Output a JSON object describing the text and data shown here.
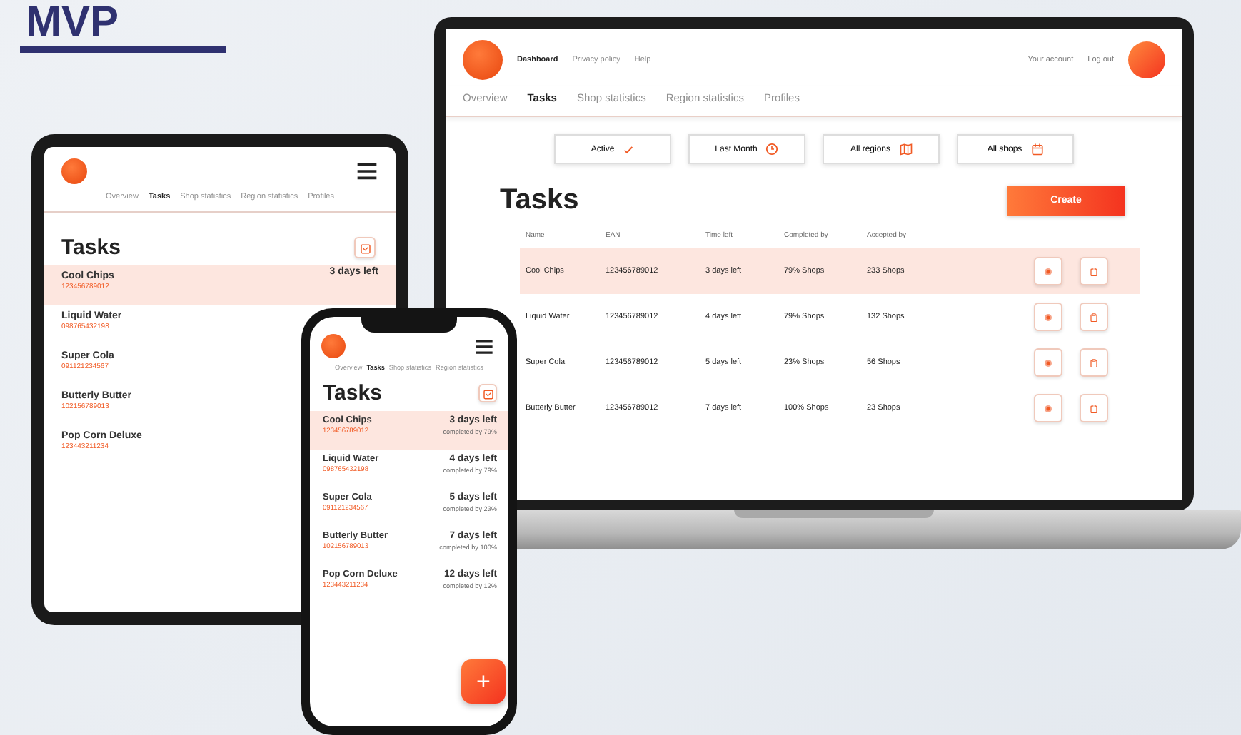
{
  "heading": "MVP",
  "laptop": {
    "top_links": [
      {
        "label": "Dashboard",
        "selected": true
      },
      {
        "label": "Privacy policy",
        "selected": false
      },
      {
        "label": "Help",
        "selected": false
      }
    ],
    "account_links": [
      "Your account",
      "Log out"
    ],
    "tabs": [
      {
        "label": "Overview",
        "selected": false
      },
      {
        "label": "Tasks",
        "selected": true
      },
      {
        "label": "Shop statistics",
        "selected": false
      },
      {
        "label": "Region statistics",
        "selected": false
      },
      {
        "label": "Profiles",
        "selected": false
      }
    ],
    "filters": [
      {
        "label": "Active"
      },
      {
        "label": "Last Month"
      },
      {
        "label": "All regions"
      },
      {
        "label": "All shops"
      }
    ],
    "title": "Tasks",
    "create_button": "Create",
    "columns": [
      "Name",
      "EAN",
      "Time left",
      "Completed by",
      "Accepted by"
    ],
    "rows": [
      {
        "cells": [
          "Cool Chips",
          "123456789012",
          "3 days left",
          "79% Shops",
          "233 Shops"
        ],
        "selected": true
      },
      {
        "cells": [
          "Liquid Water",
          "123456789012",
          "4 days left",
          "79% Shops",
          "132 Shops"
        ],
        "selected": false
      },
      {
        "cells": [
          "Super Cola",
          "123456789012",
          "5 days left",
          "23% Shops",
          "56 Shops"
        ],
        "selected": false
      },
      {
        "cells": [
          "Butterly Butter",
          "123456789012",
          "7 days left",
          "100% Shops",
          "23 Shops"
        ],
        "selected": false
      }
    ]
  },
  "tablet": {
    "tabs": [
      {
        "label": "Overview",
        "selected": false
      },
      {
        "label": "Tasks",
        "selected": true
      },
      {
        "label": "Shop statistics",
        "selected": false
      },
      {
        "label": "Region statistics",
        "selected": false
      },
      {
        "label": "Profiles",
        "selected": false
      }
    ],
    "title": "Tasks",
    "items": [
      {
        "name": "Cool Chips",
        "ean": "123456789012",
        "time_left": "3 days left",
        "selected": true
      },
      {
        "name": "Liquid Water",
        "ean": "098765432198",
        "selected": false
      },
      {
        "name": "Super Cola",
        "ean": "091121234567",
        "selected": false
      },
      {
        "name": "Butterly Butter",
        "ean": "102156789013",
        "selected": false
      },
      {
        "name": "Pop Corn Deluxe",
        "ean": "123443211234",
        "selected": false
      }
    ]
  },
  "phone": {
    "tabs": [
      {
        "label": "Overview",
        "selected": false
      },
      {
        "label": "Tasks",
        "selected": true
      },
      {
        "label": "Shop statistics",
        "selected": false
      },
      {
        "label": "Region statistics",
        "selected": false
      }
    ],
    "title": "Tasks",
    "items": [
      {
        "name": "Cool Chips",
        "ean": "123456789012",
        "time_left": "3 days left",
        "completed": "completed by 79%",
        "selected": true
      },
      {
        "name": "Liquid Water",
        "ean": "098765432198",
        "time_left": "4 days left",
        "completed": "completed by 79%",
        "selected": false
      },
      {
        "name": "Super Cola",
        "ean": "091121234567",
        "time_left": "5 days left",
        "completed": "completed by 23%",
        "selected": false
      },
      {
        "name": "Butterly Butter",
        "ean": "102156789013",
        "time_left": "7 days left",
        "completed": "completed by 100%",
        "selected": false
      },
      {
        "name": "Pop Corn Deluxe",
        "ean": "123443211234",
        "time_left": "12 days left",
        "completed": "completed by 12%",
        "selected": false
      }
    ],
    "fab": "+"
  }
}
